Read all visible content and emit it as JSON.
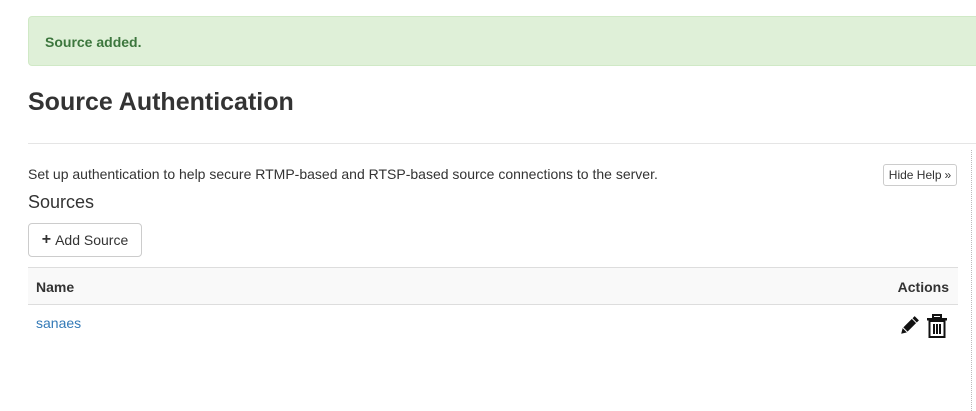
{
  "alert": {
    "message": "Source added."
  },
  "page": {
    "title": "Source Authentication",
    "help_text": "Set up authentication to help secure RTMP-based and RTSP-based source connections to the server.",
    "hide_help_label": "Hide Help",
    "hide_help_icon": "»"
  },
  "sources": {
    "heading": "Sources",
    "add_button_icon": "plus-icon",
    "add_button_label": "Add Source",
    "columns": {
      "name": "Name",
      "actions": "Actions"
    },
    "rows": [
      {
        "name": "sanaes",
        "actions": [
          "edit-pencil-icon",
          "delete-trash-icon"
        ]
      }
    ]
  },
  "colors": {
    "alert_bg": "#dff0d8",
    "alert_text": "#3c763d",
    "link": "#337ab7"
  }
}
